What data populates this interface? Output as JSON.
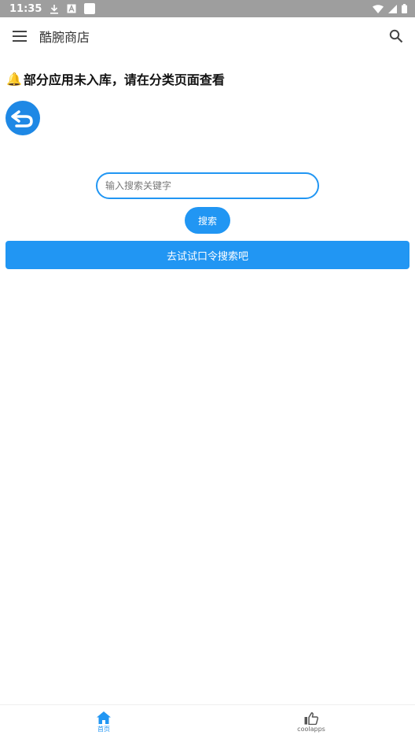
{
  "status_bar": {
    "time": "11:35",
    "icons": [
      "download-icon",
      "a-box-icon",
      "white-square-icon",
      "wifi-icon",
      "signal-icon",
      "battery-icon"
    ]
  },
  "app_bar": {
    "title": "酷腕商店",
    "menu_icon": "menu-icon",
    "search_icon": "search-icon"
  },
  "notice": {
    "emoji": "🔔",
    "text": "部分应用未入库，请在分类页面查看"
  },
  "back_button": {
    "icon": "back-arrow-icon"
  },
  "search": {
    "placeholder": "输入搜索关键字",
    "value": "",
    "submit_label": "搜索"
  },
  "password_search": {
    "label": "去试试口令搜索吧"
  },
  "bottom_nav": {
    "items": [
      {
        "label": "首页",
        "icon": "home-icon",
        "active": true
      },
      {
        "label": "coolapps",
        "icon": "thumbs-up-icon",
        "active": false
      }
    ]
  },
  "colors": {
    "accent": "#2196f3",
    "back_button": "#1e88e5",
    "status_bar": "#9e9e9e"
  }
}
